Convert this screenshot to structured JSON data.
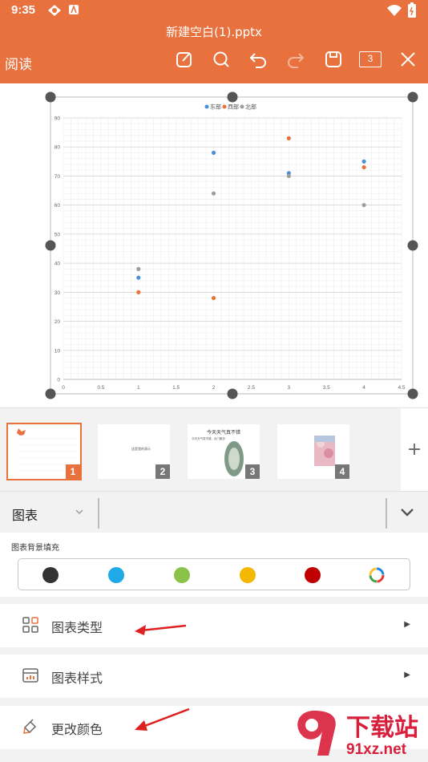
{
  "status": {
    "time": "9:35"
  },
  "header": {
    "file_title": "新建空白(1).pptx",
    "read_label": "阅读",
    "page_count": "3"
  },
  "chart_data": {
    "type": "scatter",
    "legend": [
      "东部",
      "西部",
      "北部"
    ],
    "legend_position": "top",
    "series": [
      {
        "name": "东部",
        "color": "#4a90d9",
        "x": [
          1,
          2,
          3,
          4
        ],
        "y": [
          35,
          78,
          71,
          75
        ]
      },
      {
        "name": "西部",
        "color": "#e8713e",
        "x": [
          1,
          2,
          3,
          4
        ],
        "y": [
          30,
          28,
          83,
          73
        ]
      },
      {
        "name": "北部",
        "color": "#9e9e9e",
        "x": [
          1,
          2,
          3,
          4
        ],
        "y": [
          38,
          64,
          70,
          60
        ]
      }
    ],
    "xlim": [
      0,
      4.5
    ],
    "ylim": [
      0,
      90
    ],
    "x_ticks": [
      "0",
      "0.5",
      "1",
      "1.5",
      "2",
      "2.5",
      "3",
      "3.5",
      "4",
      "4.5"
    ],
    "y_ticks": [
      "0",
      "10",
      "20",
      "30",
      "40",
      "50",
      "60",
      "70",
      "80",
      "90"
    ],
    "grid": true
  },
  "thumbnails": [
    {
      "num": "1",
      "text": ""
    },
    {
      "num": "2",
      "text": "这是我的演示"
    },
    {
      "num": "3",
      "title": "今天天气真不错",
      "text": "今天天气真不错，出门散步"
    },
    {
      "num": "4",
      "text": ""
    }
  ],
  "add_slide": "+",
  "toolbar": {
    "tab_label": "图表"
  },
  "fill_panel": {
    "label": "图表背景填充",
    "swatches": [
      "#333333",
      "#1fa9e6",
      "#8bc34a",
      "#f5b800",
      "#c00000"
    ]
  },
  "menu": [
    {
      "label": "图表类型",
      "icon": "grid-icon"
    },
    {
      "label": "图表样式",
      "icon": "chart-style-icon"
    },
    {
      "label": "更改颜色",
      "icon": "paint-bucket-icon"
    }
  ],
  "watermark": {
    "text": "下载站",
    "url": "91xz.net"
  }
}
